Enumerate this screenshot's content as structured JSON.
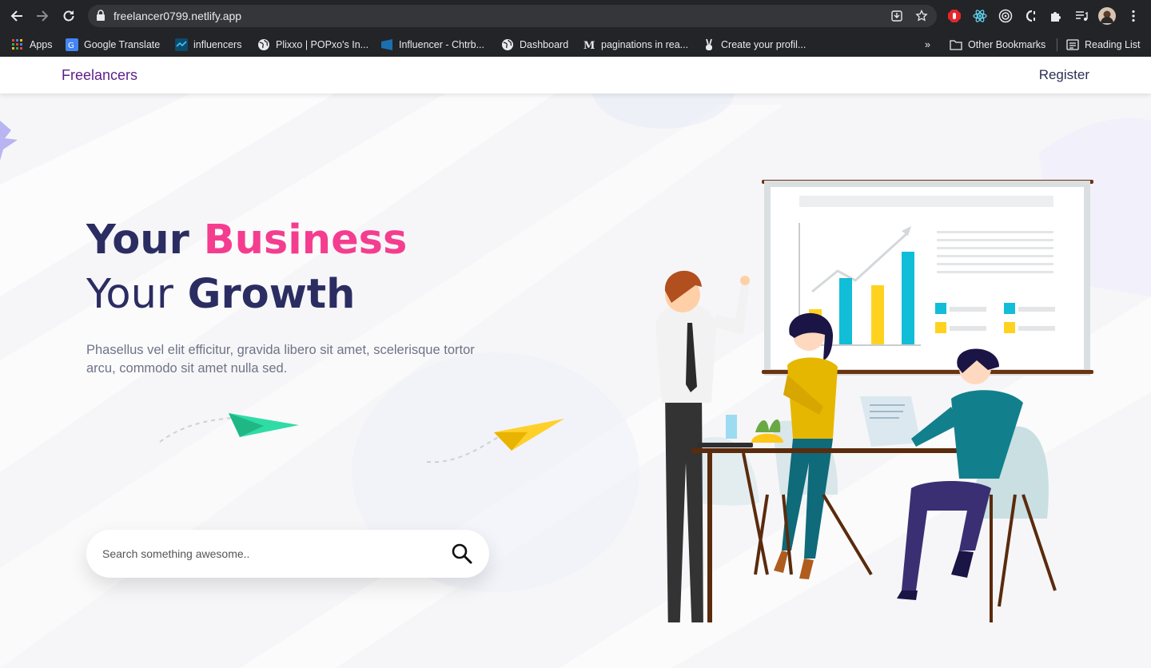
{
  "browser": {
    "url": "freelancer0799.netlify.app",
    "bookmarks": [
      {
        "label": "Apps",
        "icon": "apps-grid-icon"
      },
      {
        "label": "Google Translate",
        "icon": "google-translate-icon"
      },
      {
        "label": "influencers",
        "icon": "influencers-icon"
      },
      {
        "label": "Plixxo | POPxo's In...",
        "icon": "globe-icon"
      },
      {
        "label": "Influencer - Chtrb...",
        "icon": "chtrbox-icon"
      },
      {
        "label": "Dashboard",
        "icon": "globe-icon"
      },
      {
        "label": "paginations in rea...",
        "icon": "medium-icon"
      },
      {
        "label": "Create your profil...",
        "icon": "peace-hand-icon"
      }
    ],
    "overflow": "»",
    "other_bookmarks": "Other Bookmarks",
    "reading_list": "Reading List"
  },
  "navbar": {
    "brand": "Freelancers",
    "register": "Register"
  },
  "hero": {
    "title_word1": "Your",
    "title_highlight": "Business",
    "title_line2_plain": "Your",
    "title_line2_bold": "Growth",
    "description": "Phasellus vel elit efficitur, gravida libero sit amet, scelerisque tortor arcu, commodo sit amet nulla sed."
  },
  "search": {
    "placeholder": "Search something awesome.."
  },
  "colors": {
    "brand": "#5d1f8a",
    "title": "#2b2d62",
    "highlight": "#f53d8f",
    "chrome_bg": "#232427"
  }
}
